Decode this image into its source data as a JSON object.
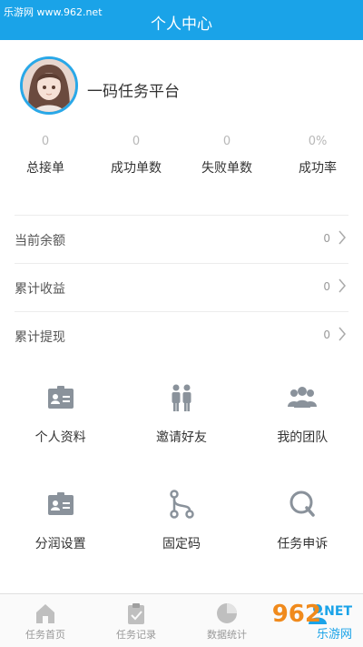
{
  "watermark": {
    "top_left": "乐游网 www.962.net",
    "brand_number": "962",
    "brand_suffix": ".NET",
    "brand_cn": "乐游网"
  },
  "header": {
    "title": "个人中心"
  },
  "profile": {
    "name": "一码任务平台"
  },
  "stats": [
    {
      "value": "0",
      "label": "总接单"
    },
    {
      "value": "0",
      "label": "成功单数"
    },
    {
      "value": "0",
      "label": "失败单数"
    },
    {
      "value": "0%",
      "label": "成功率"
    }
  ],
  "account": [
    {
      "label": "当前余额",
      "value": "0"
    },
    {
      "label": "累计收益",
      "value": "0"
    },
    {
      "label": "累计提现",
      "value": "0"
    }
  ],
  "grid": [
    {
      "label": "个人资料",
      "icon": "id-card-icon"
    },
    {
      "label": "邀请好友",
      "icon": "people-icon"
    },
    {
      "label": "我的团队",
      "icon": "team-icon"
    },
    {
      "label": "分润设置",
      "icon": "id-card-icon"
    },
    {
      "label": "固定码",
      "icon": "branch-icon"
    },
    {
      "label": "任务申诉",
      "icon": "search-q-icon"
    }
  ],
  "tabs": [
    {
      "label": "任务首页",
      "icon": "home-icon"
    },
    {
      "label": "任务记录",
      "icon": "clipboard-icon"
    },
    {
      "label": "数据统计",
      "icon": "pie-chart-icon"
    },
    {
      "label": "",
      "icon": "user-icon"
    }
  ],
  "colors": {
    "primary": "#1aa3e8",
    "icon_gray": "#8a929b",
    "tab_gray": "#bfbfbf"
  }
}
